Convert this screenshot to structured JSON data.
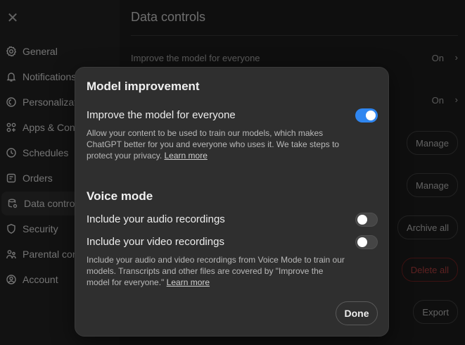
{
  "settings": {
    "close_glyph": "✕",
    "sidebar": {
      "items": [
        {
          "label": "General",
          "icon": "gear-icon"
        },
        {
          "label": "Notifications",
          "icon": "bell-icon"
        },
        {
          "label": "Personalization",
          "icon": "personalization-icon"
        },
        {
          "label": "Apps & Connectors",
          "icon": "apps-icon"
        },
        {
          "label": "Schedules",
          "icon": "clock-icon"
        },
        {
          "label": "Orders",
          "icon": "orders-icon"
        },
        {
          "label": "Data controls",
          "icon": "data-icon"
        },
        {
          "label": "Security",
          "icon": "shield-icon"
        },
        {
          "label": "Parental controls",
          "icon": "parental-icon"
        },
        {
          "label": "Account",
          "icon": "account-icon"
        }
      ]
    },
    "main": {
      "title": "Data controls",
      "rows": [
        {
          "label": "Improve the model for everyone",
          "value": "On"
        },
        {
          "label": "",
          "value": "On"
        }
      ],
      "buttons": [
        "Manage",
        "Manage",
        "Archive all",
        "Delete all",
        "Export"
      ]
    }
  },
  "modal": {
    "title": "Model improvement",
    "improve": {
      "label": "Improve the model for everyone",
      "desc": "Allow your content to be used to train our models, which makes ChatGPT better for you and everyone who uses it. We take steps to protect your privacy.",
      "link": "Learn more",
      "toggle": "on"
    },
    "voice": {
      "section": "Voice mode",
      "audio_label": "Include your audio recordings",
      "audio_toggle": "off",
      "video_label": "Include your video recordings",
      "video_toggle": "off",
      "desc": "Include your audio and video recordings from Voice Mode to train our models. Transcripts and other files are covered by \"Improve the model for everyone.\"",
      "link": "Learn more"
    },
    "done_label": "Done"
  },
  "colors": {
    "accent": "#2f86f0",
    "modal_bg": "#2f2f2f",
    "danger": "#a33a3a"
  }
}
